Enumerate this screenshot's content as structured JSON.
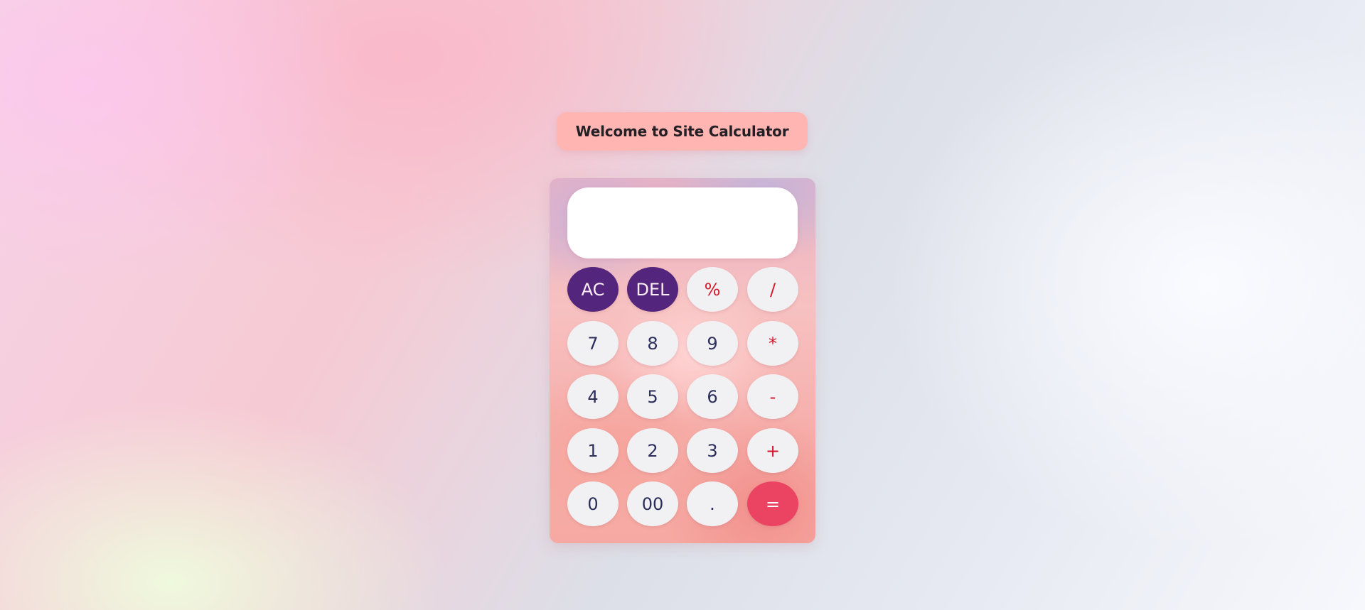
{
  "header": {
    "title": "Welcome to Site Calculator"
  },
  "display": {
    "value": ""
  },
  "keys": {
    "clear": "AC",
    "delete": "DEL",
    "percent": "%",
    "divide": "/",
    "seven": "7",
    "eight": "8",
    "nine": "9",
    "multiply": "*",
    "four": "4",
    "five": "5",
    "six": "6",
    "subtract": "-",
    "one": "1",
    "two": "2",
    "three": "3",
    "add": "+",
    "zero": "0",
    "double_zero": "00",
    "decimal": ".",
    "equals": "="
  },
  "colors": {
    "title_background": "#ffb6b3",
    "function_key": "#53257c",
    "equals_key": "#ea4462",
    "operator_text": "#d3172a",
    "digit_text": "#2b2e5a",
    "key_background": "#f1f0f2"
  }
}
